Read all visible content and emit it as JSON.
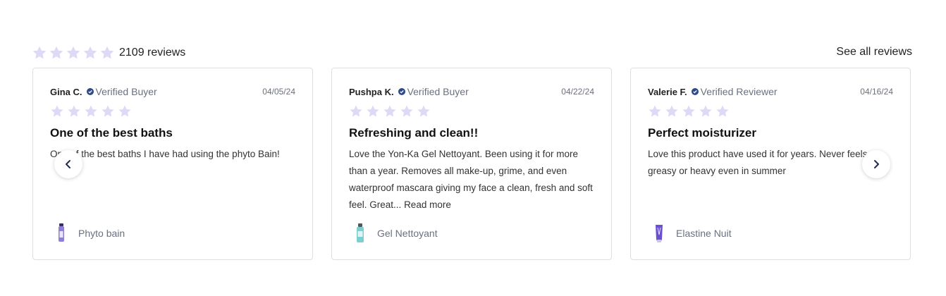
{
  "summary": {
    "count_label": "2109 reviews",
    "see_all_label": "See all reviews",
    "star_color": "#ddd9f7"
  },
  "reviews": [
    {
      "name": "Gina C.",
      "badge": "Verified Buyer",
      "date": "04/05/24",
      "rating": 5,
      "title": "One of the best baths",
      "body": "One of the best baths I have had using the phyto Bain!",
      "read_more": "",
      "product": "Phyto bain",
      "product_icon": "purple-bottle-icon"
    },
    {
      "name": "Pushpa K.",
      "badge": "Verified Buyer",
      "date": "04/22/24",
      "rating": 5,
      "title": "Refreshing and clean!!",
      "body": "Love the Yon-Ka Gel Nettoyant. Been using it for more than a year. Removes all make-up, grime, and even waterproof mascara giving my face a clean, fresh and soft feel. Great...",
      "read_more": "Read more",
      "product": "Gel Nettoyant",
      "product_icon": "teal-bottle-icon"
    },
    {
      "name": "Valerie F.",
      "badge": "Verified Reviewer",
      "date": "04/16/24",
      "rating": 5,
      "title": "Perfect moisturizer",
      "body": "Love this product have used it for years. Never feels greasy or heavy even in summer",
      "read_more": "",
      "product": "Elastine Nuit",
      "product_icon": "violet-tube-icon"
    }
  ],
  "colors": {
    "verified_badge": "#2f4a8a",
    "muted_text": "#6b7080"
  },
  "nav": {
    "prev_icon": "chevron-left-icon",
    "next_icon": "chevron-right-icon"
  }
}
